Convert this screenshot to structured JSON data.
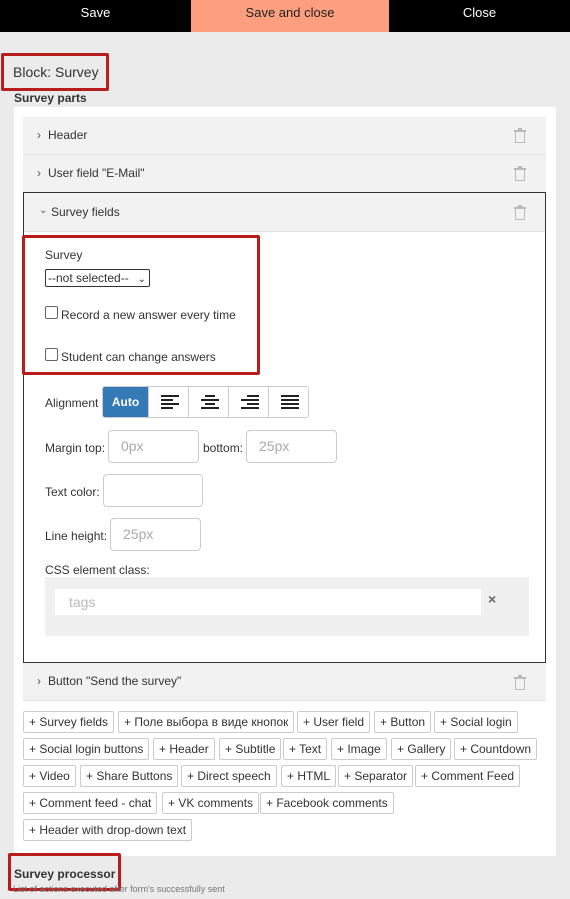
{
  "toolbar": {
    "save": "Save",
    "save_and_close": "Save and close",
    "close": "Close"
  },
  "block_title": "Block: Survey",
  "survey_parts_title": "Survey parts",
  "accordion": {
    "header": "Header",
    "user_field": "User field \"E-Mail\"",
    "survey_fields": "Survey fields",
    "button": "Button \"Send the survey\""
  },
  "form": {
    "survey_label": "Survey",
    "survey_select_value": "--not selected--",
    "record_new_answer": "Record a new answer every time",
    "student_change": "Student can change answers",
    "alignment_label": "Alignment",
    "alignment_auto": "Auto",
    "margin_top_label": "Margin top:",
    "margin_top_placeholder": "0px",
    "bottom_label": "bottom:",
    "bottom_placeholder": "25px",
    "text_color_label": "Text color:",
    "line_height_label": "Line height:",
    "line_height_placeholder": "25px",
    "css_class_label": "CSS element class:",
    "tags_placeholder": "tags",
    "clear_symbol": "×"
  },
  "add_buttons": [
    "+ Survey fields",
    "+ Поле выбора в виде кнопок",
    "+ User field",
    "+ Button",
    "+ Social login",
    "+ Social login buttons",
    "+ Header",
    "+ Subtitle",
    "+ Text",
    "+ Image",
    "+ Gallery",
    "+ Countdown",
    "+ Video",
    "+ Share Buttons",
    "+ Direct speech",
    "+ HTML",
    "+ Separator",
    "+ Comment Feed",
    "+ Comment feed - chat",
    "+ VK comments",
    "+ Facebook comments",
    "+ Header with drop-down text"
  ],
  "survey_processor_title": "Survey processor",
  "survey_processor_note": "List of actions executed after form's successfully sent",
  "icons": {
    "chevron_right": "chevron-right-icon",
    "chevron_down": "chevron-down-icon",
    "trash": "trash-icon",
    "align_left": "align-left-icon",
    "align_center": "align-center-icon",
    "align_right": "align-right-icon",
    "align_justify": "align-justify-icon"
  },
  "colors": {
    "accent": "#fd9f7e",
    "highlight_border": "#b81c1c",
    "active_button": "#337ab7"
  }
}
